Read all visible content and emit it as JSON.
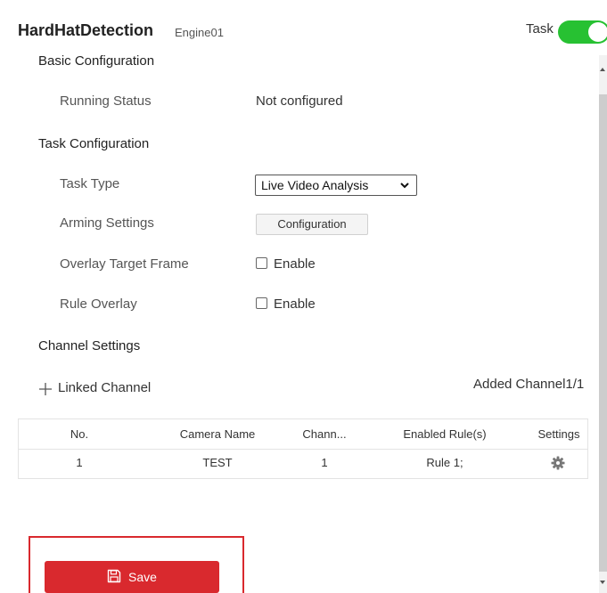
{
  "header": {
    "title": "HardHatDetection",
    "engine": "Engine01",
    "task_label": "Task",
    "task_enabled": true
  },
  "basic": {
    "section_title": "Basic Configuration",
    "running_status_label": "Running Status",
    "running_status_value": "Not configured"
  },
  "task": {
    "section_title": "Task Configuration",
    "task_type_label": "Task Type",
    "task_type_value": "Live Video Analysis",
    "arming_label": "Arming Settings",
    "arming_button": "Configuration",
    "overlay_target_label": "Overlay Target Frame",
    "overlay_target_option": "Enable",
    "overlay_target_checked": false,
    "rule_overlay_label": "Rule Overlay",
    "rule_overlay_option": "Enable",
    "rule_overlay_checked": false
  },
  "channel": {
    "section_title": "Channel Settings",
    "linked_label": "Linked Channel",
    "added_label": "Added Channel1/1",
    "table": {
      "headers": [
        "No.",
        "Camera Name",
        "Chann...",
        "Enabled Rule(s)",
        "Settings"
      ],
      "rows": [
        [
          "1",
          "TEST",
          "1",
          "Rule 1;"
        ]
      ]
    }
  },
  "actions": {
    "save_label": "Save"
  },
  "colors": {
    "toggle_on": "#27c132",
    "save_button": "#d9292e",
    "highlight_frame": "#d9292e"
  },
  "icons": {
    "linked_add": "plus-icon",
    "settings": "gear-icon",
    "save": "floppy-disk-icon",
    "select_caret": "chevron-down-icon"
  }
}
